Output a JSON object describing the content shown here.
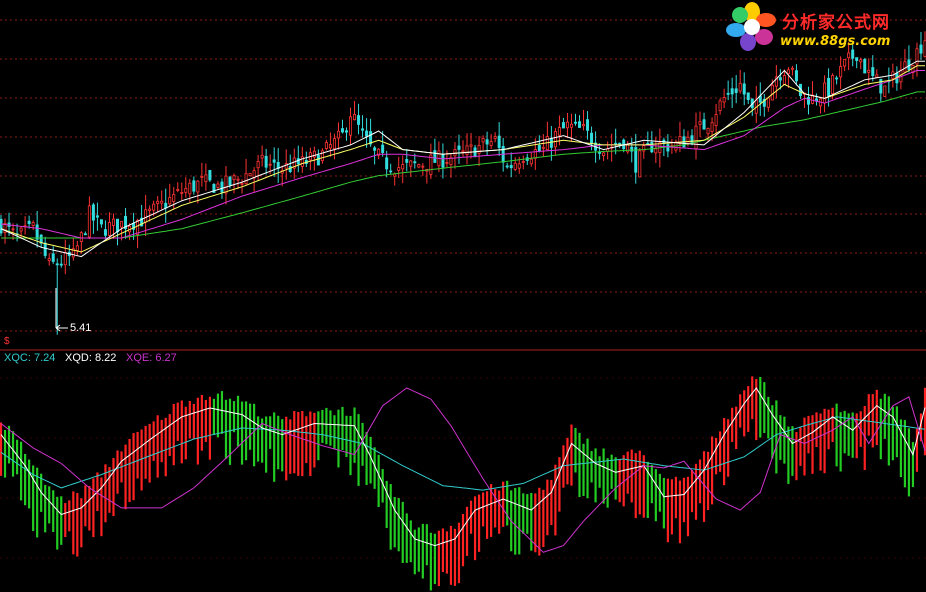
{
  "watermark": {
    "site_name": "分析家公式网",
    "site_url": "www.88gs.com",
    "flower_icon": "flower-logo-icon"
  },
  "price_panel": {
    "low_marker": "5.41",
    "period_marker": "$"
  },
  "indicator_panel": {
    "legend": [
      {
        "key": "XQC",
        "text": "XQC: 7.24",
        "color": "#33cccc"
      },
      {
        "key": "XQD",
        "text": "XQD: 8.22",
        "color": "#ffffff"
      },
      {
        "key": "XQE",
        "text": "XQE: 6.27",
        "color": "#cc33cc"
      }
    ]
  },
  "colors": {
    "background": "#000000",
    "grid": "#8b1a1a",
    "up": "#ff3333",
    "down": "#33dddd",
    "ma_white": "#ffffff",
    "ma_yellow": "#ffff66",
    "ma_magenta": "#dd33dd",
    "ma_green": "#33cc33",
    "osc_up": "#ff2222",
    "osc_down": "#22cc22"
  },
  "chart_data": [
    {
      "type": "candlestick",
      "title": "",
      "ylim": [
        5.3,
        8.9
      ],
      "grid": true,
      "annotations": [
        "5.41"
      ],
      "ma_anchors": {
        "white": [
          [
            0,
            6.55
          ],
          [
            10,
            6.35
          ],
          [
            20,
            6.25
          ],
          [
            30,
            6.55
          ],
          [
            45,
            6.85
          ],
          [
            60,
            7.05
          ],
          [
            75,
            7.3
          ],
          [
            87,
            7.45
          ],
          [
            94,
            7.6
          ],
          [
            100,
            7.4
          ],
          [
            110,
            7.35
          ],
          [
            125,
            7.4
          ],
          [
            140,
            7.55
          ],
          [
            150,
            7.4
          ],
          [
            160,
            7.5
          ],
          [
            175,
            7.45
          ],
          [
            185,
            7.8
          ],
          [
            195,
            8.25
          ],
          [
            200,
            8.0
          ],
          [
            205,
            7.95
          ],
          [
            215,
            8.15
          ],
          [
            222,
            8.2
          ],
          [
            228,
            8.35
          ]
        ],
        "yellow": [
          [
            0,
            6.55
          ],
          [
            10,
            6.4
          ],
          [
            20,
            6.3
          ],
          [
            30,
            6.5
          ],
          [
            45,
            6.8
          ],
          [
            60,
            7.0
          ],
          [
            75,
            7.25
          ],
          [
            87,
            7.4
          ],
          [
            94,
            7.5
          ],
          [
            100,
            7.4
          ],
          [
            110,
            7.35
          ],
          [
            125,
            7.4
          ],
          [
            140,
            7.5
          ],
          [
            150,
            7.45
          ],
          [
            160,
            7.45
          ],
          [
            175,
            7.5
          ],
          [
            185,
            7.75
          ],
          [
            195,
            8.1
          ],
          [
            200,
            8.0
          ],
          [
            205,
            7.95
          ],
          [
            215,
            8.1
          ],
          [
            222,
            8.15
          ],
          [
            228,
            8.3
          ]
        ],
        "magenta": [
          [
            0,
            6.6
          ],
          [
            10,
            6.55
          ],
          [
            20,
            6.45
          ],
          [
            30,
            6.45
          ],
          [
            45,
            6.65
          ],
          [
            60,
            6.9
          ],
          [
            75,
            7.1
          ],
          [
            87,
            7.25
          ],
          [
            94,
            7.35
          ],
          [
            100,
            7.35
          ],
          [
            110,
            7.3
          ],
          [
            125,
            7.35
          ],
          [
            140,
            7.4
          ],
          [
            150,
            7.45
          ],
          [
            160,
            7.45
          ],
          [
            175,
            7.4
          ],
          [
            185,
            7.55
          ],
          [
            195,
            7.85
          ],
          [
            200,
            7.95
          ],
          [
            205,
            7.9
          ],
          [
            215,
            8.05
          ],
          [
            222,
            8.15
          ],
          [
            228,
            8.25
          ]
        ],
        "green": [
          [
            0,
            6.45
          ],
          [
            15,
            6.45
          ],
          [
            30,
            6.45
          ],
          [
            45,
            6.55
          ],
          [
            60,
            6.72
          ],
          [
            75,
            6.9
          ],
          [
            87,
            7.05
          ],
          [
            94,
            7.12
          ],
          [
            100,
            7.15
          ],
          [
            110,
            7.2
          ],
          [
            125,
            7.27
          ],
          [
            140,
            7.35
          ],
          [
            150,
            7.38
          ],
          [
            160,
            7.4
          ],
          [
            170,
            7.45
          ],
          [
            180,
            7.55
          ],
          [
            190,
            7.65
          ],
          [
            200,
            7.72
          ],
          [
            210,
            7.82
          ],
          [
            220,
            7.92
          ],
          [
            228,
            8.02
          ]
        ]
      },
      "close_anchors": [
        [
          0,
          6.6
        ],
        [
          4,
          6.45
        ],
        [
          8,
          6.55
        ],
        [
          12,
          6.15
        ],
        [
          15,
          6.2
        ],
        [
          18,
          6.25
        ],
        [
          20,
          6.45
        ],
        [
          22,
          6.7
        ],
        [
          25,
          6.55
        ],
        [
          30,
          6.6
        ],
        [
          35,
          6.65
        ],
        [
          40,
          6.8
        ],
        [
          45,
          6.95
        ],
        [
          50,
          7.05
        ],
        [
          55,
          7.0
        ],
        [
          60,
          7.1
        ],
        [
          65,
          7.25
        ],
        [
          70,
          7.2
        ],
        [
          75,
          7.25
        ],
        [
          80,
          7.35
        ],
        [
          85,
          7.55
        ],
        [
          87,
          7.8
        ],
        [
          90,
          7.55
        ],
        [
          93,
          7.35
        ],
        [
          96,
          7.25
        ],
        [
          100,
          7.2
        ],
        [
          105,
          7.25
        ],
        [
          110,
          7.3
        ],
        [
          115,
          7.35
        ],
        [
          120,
          7.45
        ],
        [
          123,
          7.5
        ],
        [
          126,
          7.2
        ],
        [
          130,
          7.35
        ],
        [
          135,
          7.4
        ],
        [
          138,
          7.55
        ],
        [
          141,
          7.65
        ],
        [
          145,
          7.6
        ],
        [
          150,
          7.4
        ],
        [
          155,
          7.5
        ],
        [
          158,
          7.25
        ],
        [
          162,
          7.45
        ],
        [
          168,
          7.45
        ],
        [
          172,
          7.55
        ],
        [
          176,
          7.7
        ],
        [
          180,
          7.95
        ],
        [
          184,
          8.1
        ],
        [
          187,
          7.8
        ],
        [
          190,
          7.95
        ],
        [
          193,
          8.2
        ],
        [
          196,
          8.3
        ],
        [
          199,
          8.0
        ],
        [
          202,
          7.95
        ],
        [
          206,
          8.05
        ],
        [
          210,
          8.3
        ],
        [
          213,
          8.45
        ],
        [
          216,
          8.2
        ],
        [
          220,
          8.05
        ],
        [
          224,
          8.25
        ],
        [
          228,
          8.45
        ],
        [
          230,
          8.6
        ]
      ]
    },
    {
      "type": "line",
      "title": "",
      "ylim": [
        0,
        10
      ],
      "series": [
        {
          "name": "XQC",
          "color": "#33cccc",
          "anchors": [
            [
              0,
              6.2
            ],
            [
              8,
              5.2
            ],
            [
              15,
              4.6
            ],
            [
              25,
              5.2
            ],
            [
              35,
              5.9
            ],
            [
              48,
              6.8
            ],
            [
              60,
              7.3
            ],
            [
              70,
              7.2
            ],
            [
              80,
              7.0
            ],
            [
              90,
              6.6
            ],
            [
              100,
              5.6
            ],
            [
              110,
              4.7
            ],
            [
              120,
              4.5
            ],
            [
              130,
              4.8
            ],
            [
              140,
              5.6
            ],
            [
              155,
              5.9
            ],
            [
              165,
              5.6
            ],
            [
              175,
              5.4
            ],
            [
              185,
              6.0
            ],
            [
              193,
              7.0
            ],
            [
              200,
              7.4
            ],
            [
              208,
              7.8
            ],
            [
              216,
              7.6
            ],
            [
              224,
              7.4
            ],
            [
              230,
              7.24
            ]
          ]
        },
        {
          "name": "XQD",
          "color": "#ffffff",
          "anchors": [
            [
              0,
              7.0
            ],
            [
              6,
              5.6
            ],
            [
              10,
              4.4
            ],
            [
              15,
              3.4
            ],
            [
              20,
              3.7
            ],
            [
              25,
              4.6
            ],
            [
              30,
              5.8
            ],
            [
              38,
              6.9
            ],
            [
              45,
              7.8
            ],
            [
              52,
              8.2
            ],
            [
              60,
              7.9
            ],
            [
              65,
              7.3
            ],
            [
              70,
              7.0
            ],
            [
              78,
              7.5
            ],
            [
              88,
              7.4
            ],
            [
              92,
              6.0
            ],
            [
              98,
              3.6
            ],
            [
              103,
              2.3
            ],
            [
              108,
              2.0
            ],
            [
              113,
              2.3
            ],
            [
              118,
              3.6
            ],
            [
              125,
              4.1
            ],
            [
              132,
              3.6
            ],
            [
              137,
              4.4
            ],
            [
              142,
              6.6
            ],
            [
              148,
              5.7
            ],
            [
              153,
              5.3
            ],
            [
              160,
              5.6
            ],
            [
              165,
              4.2
            ],
            [
              170,
              4.3
            ],
            [
              175,
              5.4
            ],
            [
              180,
              7.0
            ],
            [
              185,
              8.4
            ],
            [
              188,
              9.1
            ],
            [
              192,
              7.9
            ],
            [
              197,
              6.6
            ],
            [
              202,
              7.1
            ],
            [
              207,
              7.8
            ],
            [
              212,
              7.2
            ],
            [
              218,
              8.3
            ],
            [
              222,
              7.8
            ],
            [
              227,
              6.1
            ],
            [
              230,
              8.22
            ]
          ]
        },
        {
          "name": "XQE",
          "color": "#cc33cc",
          "anchors": [
            [
              0,
              7.5
            ],
            [
              8,
              6.4
            ],
            [
              15,
              5.7
            ],
            [
              22,
              4.6
            ],
            [
              30,
              3.7
            ],
            [
              40,
              3.7
            ],
            [
              48,
              4.6
            ],
            [
              57,
              6.1
            ],
            [
              65,
              7.5
            ],
            [
              72,
              7.0
            ],
            [
              80,
              6.5
            ],
            [
              88,
              6.1
            ],
            [
              95,
              8.3
            ],
            [
              101,
              9.1
            ],
            [
              107,
              8.6
            ],
            [
              112,
              7.4
            ],
            [
              120,
              5.0
            ],
            [
              127,
              3.1
            ],
            [
              135,
              1.7
            ],
            [
              140,
              2.0
            ],
            [
              145,
              3.1
            ],
            [
              153,
              4.6
            ],
            [
              160,
              5.6
            ],
            [
              165,
              5.5
            ],
            [
              170,
              5.8
            ],
            [
              178,
              4.1
            ],
            [
              184,
              3.6
            ],
            [
              189,
              4.4
            ],
            [
              194,
              7.0
            ],
            [
              200,
              6.6
            ],
            [
              207,
              7.2
            ],
            [
              212,
              7.8
            ],
            [
              216,
              6.6
            ],
            [
              222,
              8.3
            ],
            [
              226,
              8.7
            ],
            [
              230,
              6.27
            ]
          ]
        }
      ],
      "histogram": {
        "name": "XQD bars",
        "up_color": "#ff2222",
        "down_color": "#22cc22"
      }
    }
  ]
}
